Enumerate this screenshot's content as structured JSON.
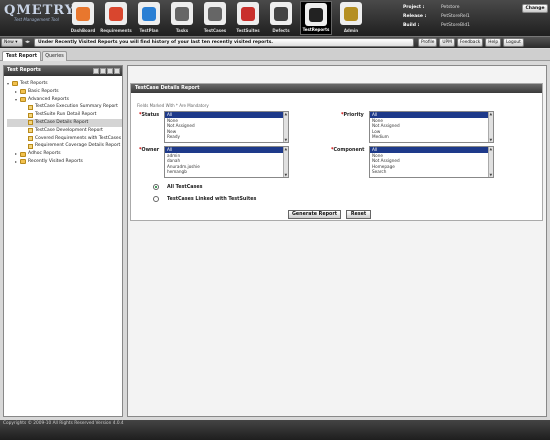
{
  "app": {
    "brand": "QMETRY",
    "tagline": "Test Management Tool"
  },
  "nav": [
    {
      "label": "DashBoard",
      "icon": "dashboard-icon",
      "color": "#e8772e",
      "active": false
    },
    {
      "label": "Requirements",
      "icon": "requirements-icon",
      "color": "#d9462e",
      "active": false
    },
    {
      "label": "TestPlan",
      "icon": "testplan-icon",
      "color": "#2a7fd4",
      "active": false
    },
    {
      "label": "Tasks",
      "icon": "tasks-icon",
      "color": "#666666",
      "active": false
    },
    {
      "label": "TestCases",
      "icon": "testcases-icon",
      "color": "#666666",
      "active": false
    },
    {
      "label": "TestSuites",
      "icon": "testsuites-icon",
      "color": "#c9302c",
      "active": false
    },
    {
      "label": "Defects",
      "icon": "defects-icon",
      "color": "#444444",
      "active": false
    },
    {
      "label": "TestReports",
      "icon": "testreports-icon",
      "color": "#222222",
      "active": true
    },
    {
      "label": "Admin",
      "icon": "admin-icon",
      "color": "#b58f22",
      "active": false
    }
  ],
  "project": {
    "project_label": "Project :",
    "project_value": "Petstore",
    "release_label": "Release :",
    "release_value": "PetStoreRel1",
    "build_label": "Build :",
    "build_value": "PetStoreBld1",
    "change_label": "Change"
  },
  "msgbar": {
    "new_label": "New",
    "message": "Under Recently Visited Reports you will find history of your last ten recently visited reports.",
    "tools": [
      "Profile",
      "UPM",
      "Feedback",
      "Help",
      "Logout"
    ]
  },
  "tabs": {
    "active": "Test Report",
    "inactive": "Queries"
  },
  "left": {
    "title": "Test Reports",
    "tree": [
      {
        "label": "Test Reports",
        "depth": 0,
        "kind": "folder",
        "twisty": "▾"
      },
      {
        "label": "Basic Reports",
        "depth": 1,
        "kind": "folder",
        "twisty": "▸"
      },
      {
        "label": "Advanced Reports",
        "depth": 1,
        "kind": "folder",
        "twisty": "▾"
      },
      {
        "label": "TestCase Execution Summary Report",
        "depth": 2,
        "kind": "doc",
        "twisty": ""
      },
      {
        "label": "TestSuite Run Detail Report",
        "depth": 2,
        "kind": "doc",
        "twisty": ""
      },
      {
        "label": "TestCase Details Report",
        "depth": 2,
        "kind": "doc",
        "twisty": "",
        "selected": true
      },
      {
        "label": "TestCase Development Report",
        "depth": 2,
        "kind": "doc",
        "twisty": ""
      },
      {
        "label": "Covered Requirements with TestCases",
        "depth": 2,
        "kind": "doc",
        "twisty": ""
      },
      {
        "label": "Requirement Coverage Details Report",
        "depth": 2,
        "kind": "doc",
        "twisty": ""
      },
      {
        "label": "Adhoc Reports",
        "depth": 1,
        "kind": "folder",
        "twisty": "▸"
      },
      {
        "label": "Recently Visited Reports",
        "depth": 1,
        "kind": "folder",
        "twisty": "▸"
      }
    ]
  },
  "report": {
    "title": "TestCase Details Report",
    "required_note": "Fields Marked With * Are Mandatory",
    "status": {
      "label": "Status",
      "options": [
        "All",
        "None",
        "Not Assigned",
        "New",
        "Ready"
      ]
    },
    "priority": {
      "label": "Priority",
      "options": [
        "All",
        "None",
        "Not Assigned",
        "Low",
        "Medium"
      ]
    },
    "owner": {
      "label": "Owner",
      "options": [
        "All",
        "admin",
        "danah",
        "Anuradm.joshie",
        "hemangb"
      ]
    },
    "component": {
      "label": "Component",
      "options": [
        "All",
        "None",
        "Not Assigned",
        "Homepage",
        "Search"
      ]
    },
    "radio_all": "All TestCases",
    "radio_linked": "TestCases Linked with TestSuites",
    "generate_label": "Generate Report",
    "reset_label": "Reset"
  },
  "footer": {
    "copyright": "Copyrights © 2009-10 All Rights Reserved Version 4.0.4"
  }
}
